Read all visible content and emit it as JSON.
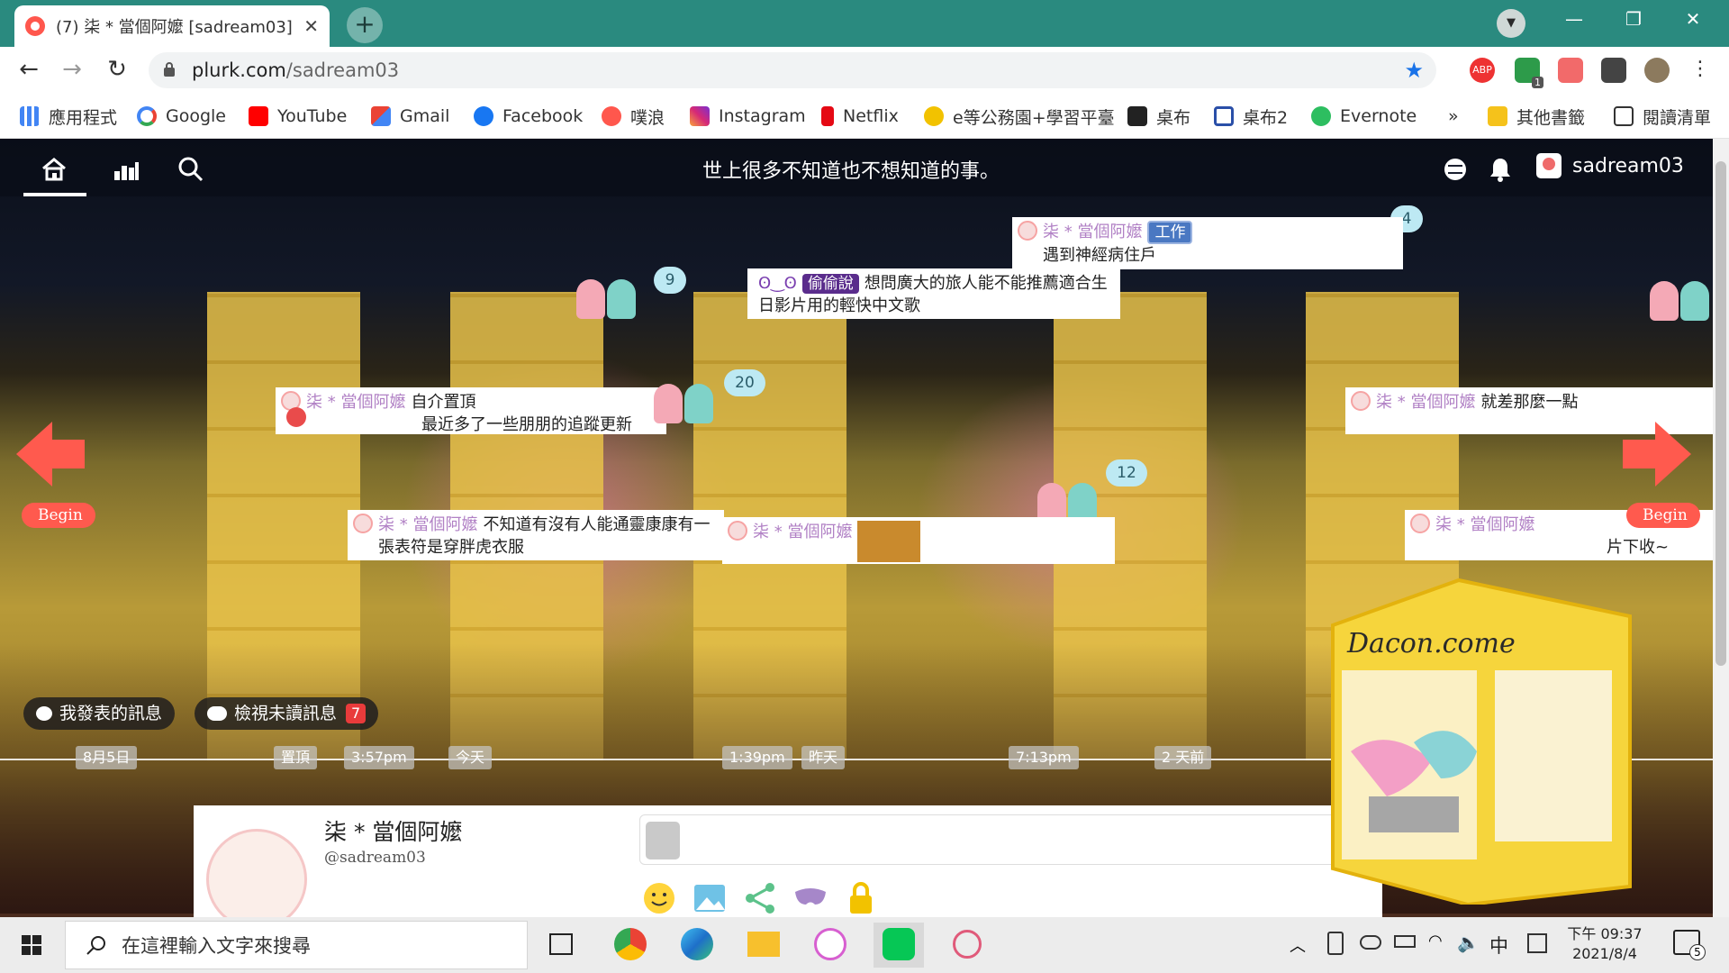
{
  "browser": {
    "tab_title": "(7) 柒 * 當個阿嬤 [sadream03] -",
    "tab_close": "✕",
    "new_tab": "+",
    "url_host": "plurk.com",
    "url_path": "/sadream03",
    "window_minimize": "—",
    "window_restore": "❐",
    "window_close": "✕",
    "ext_badge": "1",
    "abp_label": "ABP"
  },
  "bookmarks": {
    "items": [
      "應用程式",
      "Google",
      "YouTube",
      "Gmail",
      "Facebook",
      "噗浪",
      "Instagram",
      "Netflix",
      "e等公務園+學習平臺",
      "桌布",
      "桌布2",
      "Evernote"
    ],
    "more": "»",
    "other": "其他書籤",
    "reading_list": "閱讀清單"
  },
  "plurk": {
    "tagline": "世上很多不知道也不想知道的事。",
    "username": "sadream03",
    "begin_label": "Begin",
    "posts": [
      {
        "owner": "柒 * 當個阿嬤",
        "qualifier": "工作",
        "text": "遇到神經病住戶",
        "responses": "4"
      },
      {
        "owner": "ʘ‿ʘ",
        "qualifier": "偷偷說",
        "text": "想問廣大的旅人能不能推薦適合生日影片用的輕快中文歌",
        "responses": ""
      },
      {
        "owner": "柒 * 當個阿嬤",
        "qualifier": "自介置頂",
        "text": "最近多了一些朋朋的追蹤更新",
        "responses": "9"
      },
      {
        "owner": "柒 * 當個阿嬤",
        "qualifier": "",
        "text": "就差那麼一點",
        "responses": ""
      },
      {
        "owner": "柒 * 當個阿嬤",
        "qualifier": "",
        "text": "不知道有沒有人能通靈康康有一張表符是穿胖虎衣服",
        "responses": "20"
      },
      {
        "owner": "柒 * 當個阿嬤",
        "qualifier": "",
        "text": "片下收~",
        "responses": ""
      },
      {
        "owner": "柒 * 當個阿嬤",
        "qualifier": "",
        "text": "",
        "responses": "12"
      }
    ],
    "my_posts_label": "我發表的訊息",
    "unread_label": "檢視未讀訊息",
    "unread_count": "7",
    "timeline_labels": [
      "8月5日",
      "置頂",
      "3:57pm",
      "今天",
      "1:39pm",
      "昨天",
      "7:13pm",
      "2 天前"
    ],
    "composer": {
      "name": "柒 * 當個阿嬤",
      "handle": "@sadream03"
    },
    "dacon_text": "Dacon.come"
  },
  "taskbar": {
    "search_placeholder": "在這裡輸入文字來搜尋",
    "ime": "中",
    "time": "下午 09:37",
    "date": "2021/8/4",
    "notif_count": "5"
  },
  "colors": {
    "accent_coral": "#ff5a4e",
    "plurk_purple": "#b181c5",
    "tab_teal": "#2a8a7f"
  }
}
